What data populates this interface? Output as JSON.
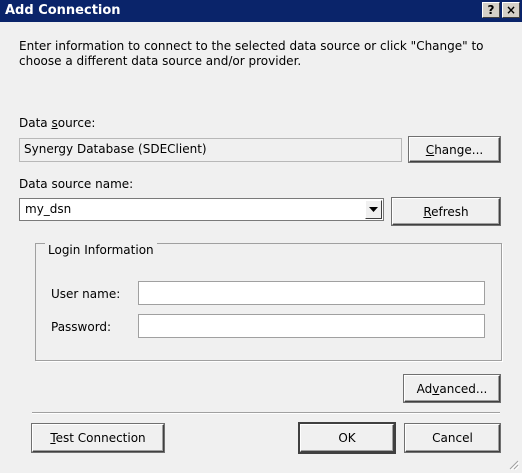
{
  "window": {
    "title": "Add Connection",
    "help_label": "?",
    "close_label": "×"
  },
  "description": "Enter information to connect to the selected data source or click \"Change\" to choose a different data source and/or provider.",
  "data_source": {
    "label_pre": "Data ",
    "label_u": "s",
    "label_post": "ource:",
    "value": "Synergy Database (SDEClient)",
    "change_pre": "",
    "change_u": "C",
    "change_post": "hange..."
  },
  "dsn": {
    "label": "Data source name:",
    "value": "my_dsn",
    "refresh_pre": "",
    "refresh_u": "R",
    "refresh_post": "efresh"
  },
  "login": {
    "legend": "Login Information",
    "username_label": "User name:",
    "username_value": "",
    "password_label": "Password:",
    "password_value": ""
  },
  "buttons": {
    "advanced_pre": "Ad",
    "advanced_u": "v",
    "advanced_post": "anced...",
    "test_pre": "",
    "test_u": "T",
    "test_post": "est Connection",
    "ok": "OK",
    "cancel": "Cancel"
  },
  "icons": {
    "dropdown": "chevron-down-icon",
    "grip": "resize-grip-icon"
  },
  "colors": {
    "titlebar": "#0a246a",
    "dialog_bg": "#f0f0f0"
  }
}
